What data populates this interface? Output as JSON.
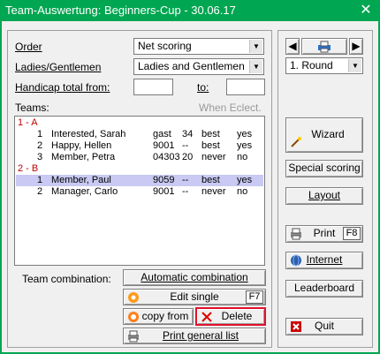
{
  "window": {
    "title": "Team-Auswertung: Beginners-Cup - 30.06.17",
    "close_glyph": "✕"
  },
  "form": {
    "order_label": "Order",
    "order_value": "Net scoring",
    "ladies_label": "Ladies/Gentlemen",
    "ladies_value": "Ladies and Gentlemen",
    "handicap_label": "Handicap total from:",
    "handicap_from": "",
    "to_label": "to:",
    "handicap_to": ""
  },
  "teams": {
    "label": "Teams:",
    "when_eclect_label": "When Eclect.",
    "rows": [
      {
        "type": "group",
        "c0": "1 - A"
      },
      {
        "type": "item",
        "c0": "1",
        "name": "Interested, Sarah",
        "hcp": "gast",
        "score": "34",
        "mode": "best",
        "flag": "yes"
      },
      {
        "type": "item",
        "c0": "2",
        "name": "Happy, Hellen",
        "hcp": "9001",
        "score": "--",
        "mode": "best",
        "flag": "yes"
      },
      {
        "type": "item",
        "c0": "3",
        "name": "Member, Petra",
        "hcp": "04303",
        "score": "20",
        "mode": "never",
        "flag": "no"
      },
      {
        "type": "group",
        "c0": "2 - B"
      },
      {
        "type": "item",
        "selected": true,
        "c0": "1",
        "name": "Member, Paul",
        "hcp": "9059",
        "score": "--",
        "mode": "best",
        "flag": "yes"
      },
      {
        "type": "item",
        "c0": "2",
        "name": "Manager, Carlo",
        "hcp": "9001",
        "score": "--",
        "mode": "never",
        "flag": "no"
      }
    ]
  },
  "combination": {
    "label": "Team combination:",
    "automatic": "Automatic combination",
    "edit_single": "Edit single",
    "edit_single_key": "F7",
    "copy_from": "copy from",
    "delete": "Delete",
    "print_list": "Print general list"
  },
  "right": {
    "round_value": "1. Round",
    "wizard": "Wizard",
    "special_scoring": "Special scoring",
    "layout": "Layout",
    "print": "Print",
    "print_key": "F8",
    "internet": "Internet",
    "leaderboard": "Leaderboard",
    "quit": "Quit"
  },
  "colors": {
    "frame": "#00a651",
    "group_text": "#c00000",
    "selection": "#c9c9f3",
    "delete_frame": "#e0112b"
  }
}
